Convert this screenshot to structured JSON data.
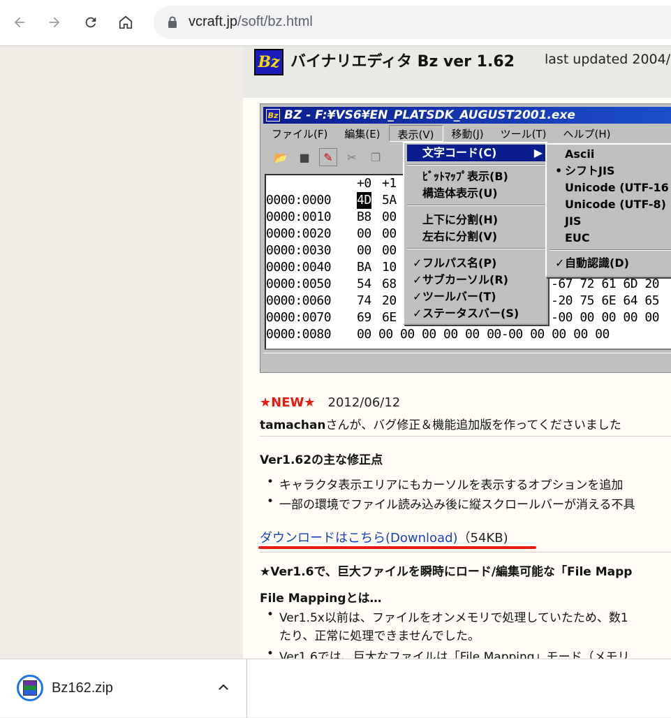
{
  "browser": {
    "url_host": "vcraft.jp",
    "url_path": "/soft/bz.html",
    "back_icon": "arrow-left-icon",
    "forward_icon": "arrow-right-icon",
    "reload_icon": "reload-icon",
    "home_icon": "home-icon",
    "lock_icon": "lock-icon"
  },
  "page": {
    "logo_text": "Bz",
    "title": "バイナリエディタ Bz ver 1.62",
    "updated": "last updated 2004/",
    "app": {
      "title": "BZ - F:¥VS6¥EN_PLATSDK_AUGUST2001.exe",
      "icon_text": "Bz",
      "menus": [
        "ファイル(F)",
        "編集(E)",
        "表示(V)",
        "移動(J)",
        "ツール(T)",
        "ヘルプ(H)"
      ],
      "hex_header": [
        "+0",
        "+1"
      ],
      "addresses": [
        "0000:0000",
        "0000:0010",
        "0000:0020",
        "0000:0030",
        "0000:0040",
        "0000:0050",
        "0000:0060",
        "0000:0070",
        "0000:0080"
      ],
      "col0": [
        "4D",
        "B8",
        "00",
        "00",
        "BA",
        "54",
        "74",
        "69",
        "00"
      ],
      "col1": [
        "5A",
        "00",
        "00",
        "00",
        "10",
        "68",
        "20",
        "6E",
        "00"
      ],
      "tail_rows": [
        {
          "text": "-67 72 61 6D 20"
        },
        {
          "text": "-20 75 6E 64 65"
        },
        {
          "text": "-00 00 00 00 00"
        },
        {
          "text": "00 00 00 00 00 00 00-00 00 00 00 00"
        }
      ],
      "view_menu": [
        {
          "label": "文字コード(C)",
          "selected": true,
          "submenu": true
        },
        {
          "label": "ﾋﾞｯﾄﾏｯﾌﾟ表示(B)"
        },
        {
          "label": "構造体表示(U)"
        },
        {
          "label": "上下に分割(H)"
        },
        {
          "label": "左右に分割(V)"
        },
        {
          "label": "フルパス名(P)",
          "checked": true
        },
        {
          "label": "サブカーソル(R)",
          "checked": true
        },
        {
          "label": "ツールバー(T)",
          "checked": true
        },
        {
          "label": "ステータスバー(S)",
          "checked": true
        }
      ],
      "code_menu": [
        {
          "label": "Ascii"
        },
        {
          "label": "シフトJIS",
          "radio": true
        },
        {
          "label": "Unicode (UTF-16"
        },
        {
          "label": "Unicode (UTF-8)"
        },
        {
          "label": "JIS"
        },
        {
          "label": "EUC"
        },
        {
          "label": "自動認識(D)",
          "checked": true
        }
      ]
    },
    "news_badge": "★NEW★",
    "news_date": "2012/06/12",
    "news_author": "tamachan",
    "news_text": "さんが、バグ修正＆機能追加版を作ってくださいました",
    "fixes_title": "Ver1.62の主な修正点",
    "fixes": [
      "キャラクタ表示エリアにもカーソルを表示するオプションを追加",
      "一部の環境でファイル読み込み後に縦スクロールバーが消える不具"
    ],
    "download_link": "ダウンロードはこちら(Download)",
    "download_size": "（54KB)",
    "v16_title": "★Ver1.6で、巨大ファイルを瞬時にロード/編集可能な「File Mapp",
    "fm_title": "File Mappingとは…",
    "fm_bullets": [
      "Ver1.5x以前は、ファイルをオンメモリで処理していたため、数1",
      "たり、正常に処理できませんでした。",
      "Ver1.6では、巨大なファイルは「File Mapping」モード（メモリ"
    ]
  },
  "download_shelf": {
    "file_name": "Bz162.zip",
    "file_icon": "winrar-archive-icon",
    "chevron_icon": "chevron-up-icon"
  }
}
